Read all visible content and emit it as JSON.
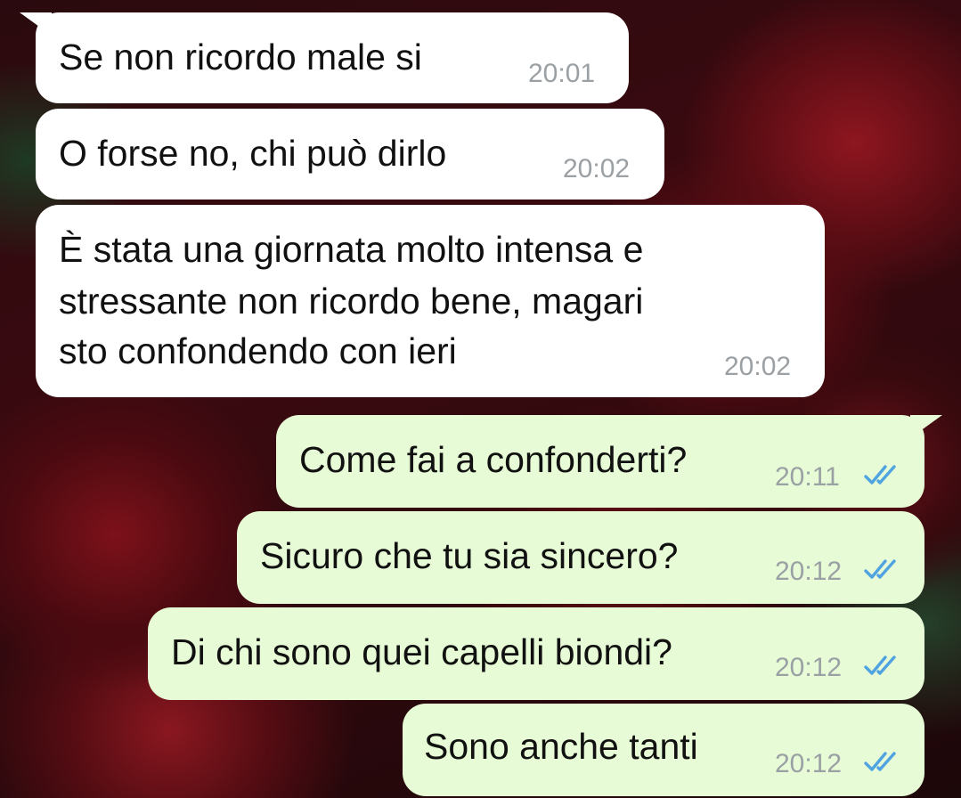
{
  "messages": [
    {
      "direction": "incoming",
      "text": "Se non ricordo male si",
      "time": "20:01"
    },
    {
      "direction": "incoming",
      "text": "O forse no, chi può dirlo",
      "time": "20:02"
    },
    {
      "direction": "incoming",
      "lines": [
        "È stata una giornata molto intensa e",
        "stressante non ricordo bene, magari",
        "sto confondendo con ieri"
      ],
      "time": "20:02"
    },
    {
      "direction": "outgoing",
      "text": "Come fai a confonderti?",
      "time": "20:11",
      "status": "read"
    },
    {
      "direction": "outgoing",
      "text": "Sicuro che tu sia sincero?",
      "time": "20:12",
      "status": "read"
    },
    {
      "direction": "outgoing",
      "text": "Di chi sono quei capelli biondi?",
      "time": "20:12",
      "status": "read"
    },
    {
      "direction": "outgoing",
      "text": "Sono anche tanti",
      "time": "20:12",
      "status": "read"
    }
  ],
  "colors": {
    "incoming_bubble": "#ffffff",
    "outgoing_bubble": "#e7fcd6",
    "timestamp": "#9aa0a3",
    "read_ticks": "#4fa3e0"
  },
  "icons": {
    "read_status": "double-check-icon"
  }
}
